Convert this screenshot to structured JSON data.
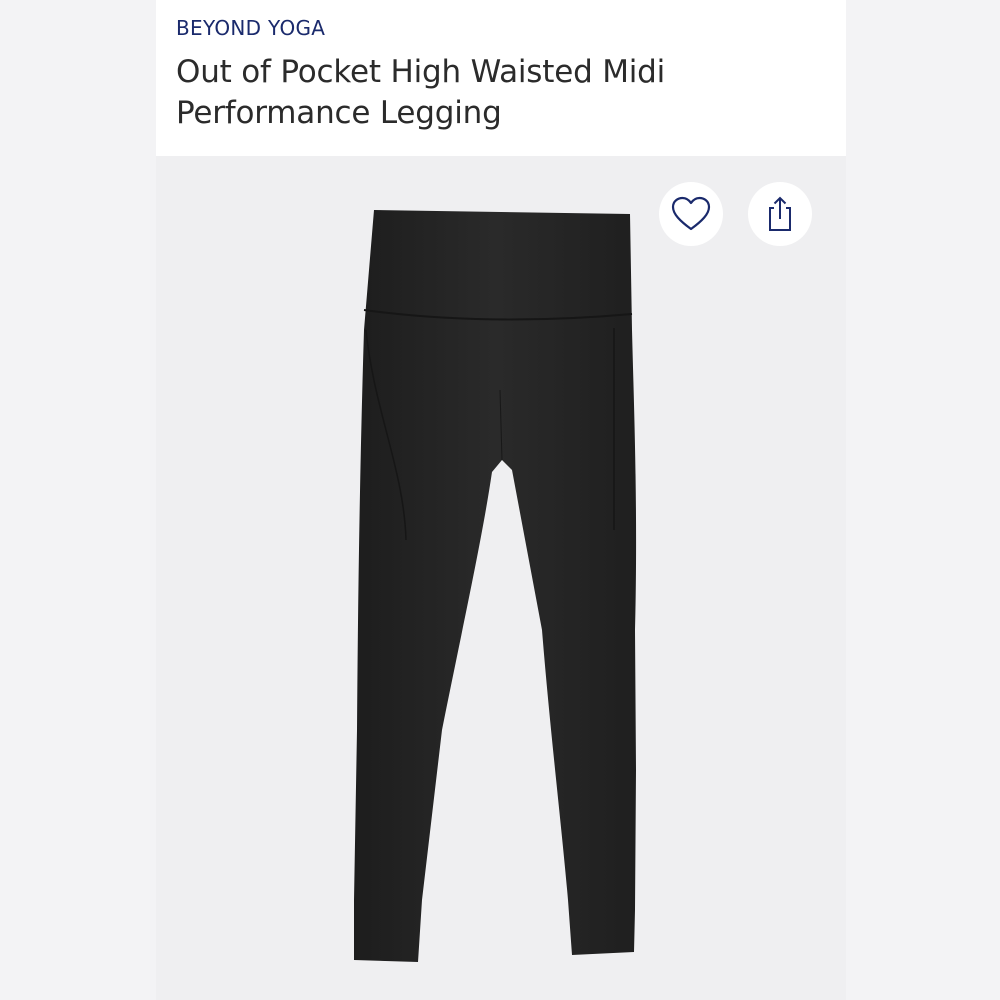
{
  "product": {
    "brand": "BEYOND YOGA",
    "title": "Out of Pocket High Waisted Midi Performance Legging"
  },
  "actions": {
    "favorite_icon": "heart-icon",
    "share_icon": "share-icon"
  },
  "image": {
    "subject": "legging",
    "color": "#242424"
  },
  "colors": {
    "brand": "#1a2a6c",
    "title": "#2b2b2b",
    "background": "#efeff1",
    "header": "#ffffff"
  }
}
